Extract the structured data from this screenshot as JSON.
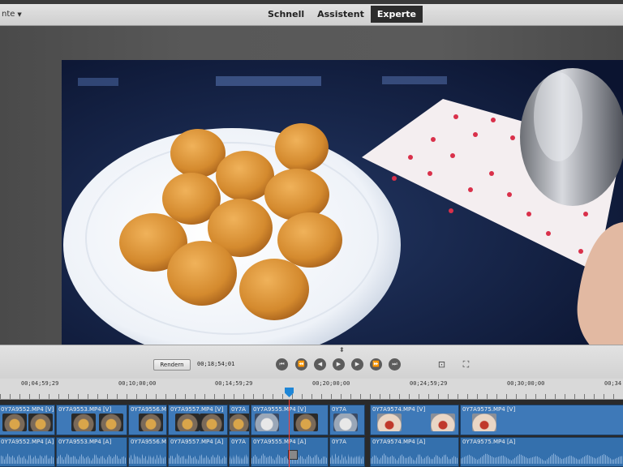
{
  "header": {
    "mode_menu_label": "nte",
    "tabs": [
      {
        "label": "Schnell",
        "active": false
      },
      {
        "label": "Assistent",
        "active": false
      },
      {
        "label": "Experte",
        "active": true
      }
    ]
  },
  "monitor": {
    "render_button_label": "Rendern",
    "timecode": "00;18;54;01",
    "transport_icons": [
      "go-to-start-icon",
      "step-back-icon",
      "frame-back-icon",
      "play-icon",
      "frame-forward-icon",
      "step-forward-icon",
      "go-to-end-icon"
    ],
    "tool_icons": [
      "safe-margins-icon",
      "fullscreen-icon"
    ]
  },
  "ruler": {
    "labels": [
      "00;04;59;29",
      "00;10;00;00",
      "00;14;59;29",
      "00;20;00;00",
      "00;24;59;29",
      "00;30;00;00",
      "00;34"
    ]
  },
  "timeline": {
    "video_clips": [
      {
        "label": "0Y7A9552.MP4 [V]"
      },
      {
        "label": "0Y7A9553.MP4 [V]"
      },
      {
        "label": "0Y7A9556.MP4 [V]"
      },
      {
        "label": "0Y7A9557.MP4 [V]"
      },
      {
        "label": "0Y7A"
      },
      {
        "label": "0Y7A9555.MP4 [V]"
      },
      {
        "label": "0Y7A"
      },
      {
        "label": "0Y7A9574.MP4 [V]"
      },
      {
        "label": "0Y7A9575.MP4 [V]"
      }
    ],
    "audio_clips": [
      {
        "label": "0Y7A9552.MP4 [A]"
      },
      {
        "label": "0Y7A9553.MP4 [A]"
      },
      {
        "label": "0Y7A9556.MP4 [A]"
      },
      {
        "label": "0Y7A9557.MP4 [A]"
      },
      {
        "label": "0Y7A"
      },
      {
        "label": "0Y7A9555.MP4 [A]"
      },
      {
        "label": "0Y7A"
      },
      {
        "label": "0Y7A9574.MP4 [A]"
      },
      {
        "label": "0Y7A9575.MP4 [A]"
      }
    ]
  },
  "colors": {
    "clip_blue": "#3e79b8",
    "playhead": "#1f86d6",
    "active_tab": "#2c2c2c"
  }
}
